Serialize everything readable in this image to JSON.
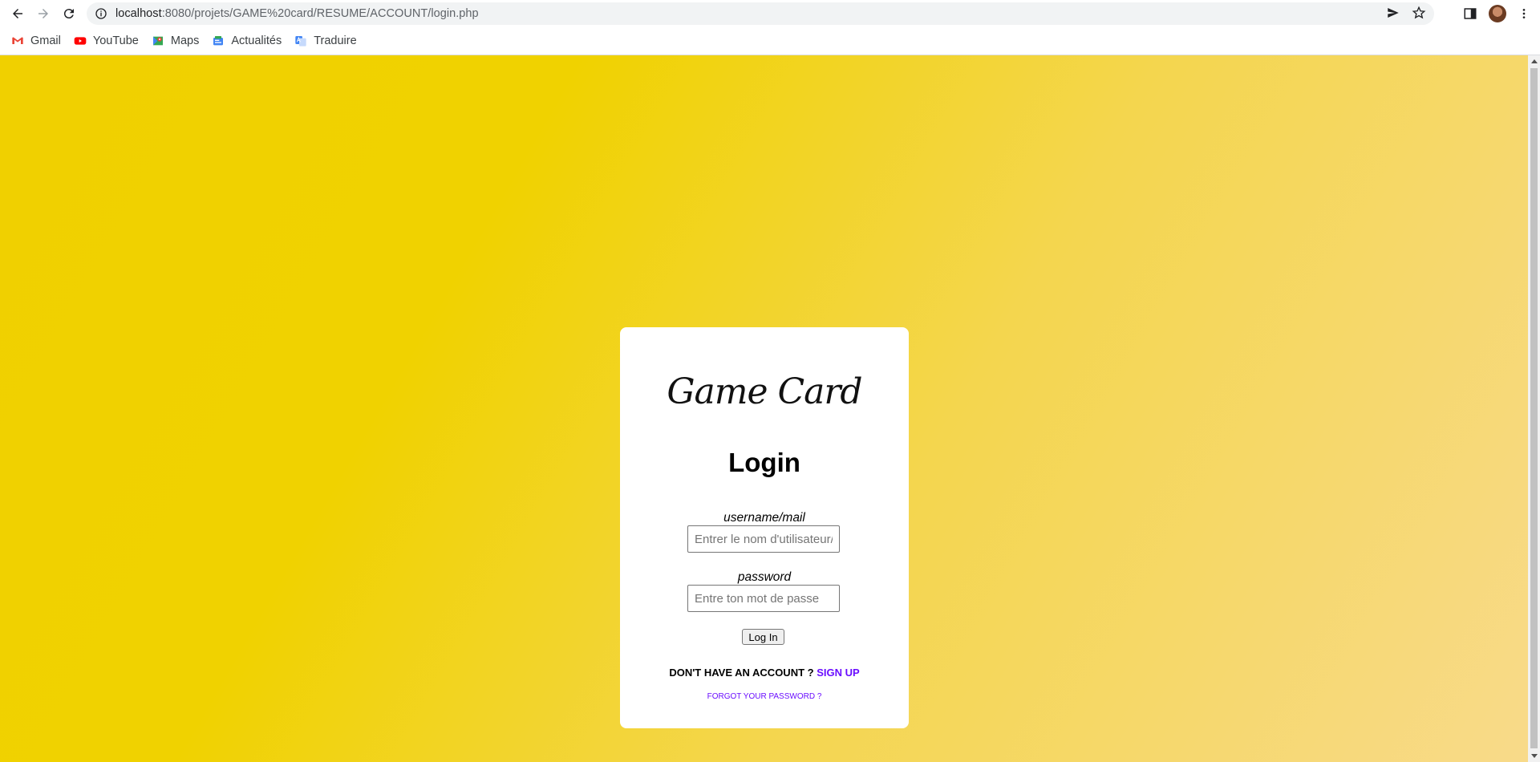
{
  "browser": {
    "url_host": "localhost",
    "url_rest": ":8080/projets/GAME%20card/RESUME/ACCOUNT/login.php"
  },
  "bookmarks": [
    {
      "label": "Gmail",
      "icon": "gmail-icon"
    },
    {
      "label": "YouTube",
      "icon": "youtube-icon"
    },
    {
      "label": "Maps",
      "icon": "maps-icon"
    },
    {
      "label": "Actualités",
      "icon": "news-icon"
    },
    {
      "label": "Traduire",
      "icon": "translate-icon"
    }
  ],
  "page": {
    "background_start": "#f0d000",
    "background_end": "#f8da8a",
    "brand": "Game Card",
    "title": "Login",
    "username_label": "username/mail",
    "username_placeholder": "Entrer le nom d'utilisateur/mail",
    "password_label": "password",
    "password_placeholder": "Entre ton mot de passe",
    "login_button": "Log In",
    "no_account_text": "DON'T HAVE AN ACCOUNT ?",
    "signup_link": "SIGN UP",
    "forgot_link": "FORGOT YOUR PASSWORD ?",
    "link_color": "#6a0dff"
  }
}
